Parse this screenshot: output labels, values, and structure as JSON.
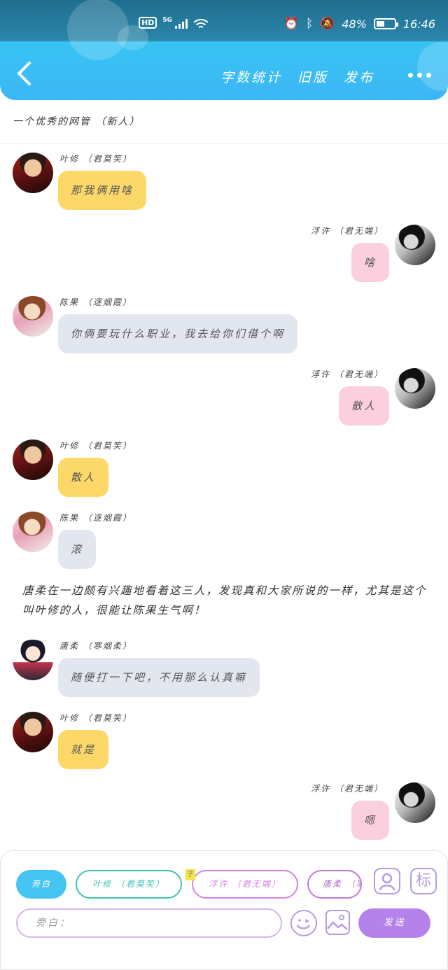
{
  "status_bar": {
    "hd_badge": "HD",
    "network": "5G",
    "battery_text": "48%",
    "battery_level": 0.48,
    "time": "16:46",
    "icons": [
      "alarm-icon",
      "bluetooth-icon",
      "vibrate-icon",
      "mute-icon"
    ]
  },
  "nav": {
    "back_icon": "chevron-left-icon",
    "links": [
      "字数统计",
      "旧版",
      "发布"
    ],
    "more_icon": "more-dots-icon"
  },
  "topic": {
    "title": "一个优秀的网管 （新人）"
  },
  "messages": [
    {
      "side": "left",
      "avatar": "ye",
      "sender": "叶修 （君莫笑）",
      "text": "那我俩用啥",
      "color": "yellow"
    },
    {
      "side": "right",
      "avatar": "fu",
      "sender": "浮许 （君无端）",
      "text": "啥",
      "color": "pink"
    },
    {
      "side": "left",
      "avatar": "chen",
      "sender": "陈果 （逐烟霞）",
      "text": "你俩要玩什么职业，我去给你们借个啊",
      "color": "gray"
    },
    {
      "side": "right",
      "avatar": "fu",
      "sender": "浮许 （君无端）",
      "text": "散人",
      "color": "pink"
    },
    {
      "side": "left",
      "avatar": "ye",
      "sender": "叶修 （君莫笑）",
      "text": "散人",
      "color": "yellow"
    },
    {
      "side": "left",
      "avatar": "chen",
      "sender": "陈果 （逐烟霞）",
      "text": "滚",
      "color": "gray"
    },
    {
      "side": "left",
      "avatar": "tang",
      "sender": "唐柔 （寒烟柔）",
      "text": "随便打一下吧，不用那么认真嘛",
      "color": "gray"
    },
    {
      "side": "left",
      "avatar": "ye",
      "sender": "叶修 （君莫笑）",
      "text": "就是",
      "color": "yellow"
    },
    {
      "side": "right",
      "avatar": "fu",
      "sender": "浮许 （君无端）",
      "text": "嗯",
      "color": "pink"
    }
  ],
  "narration": "唐柔在一边颇有兴趣地看着这三人，发现真和大家所说的一样，尤其是这个叫叶修的人，很能让陈果生气啊！",
  "composer": {
    "roles": [
      {
        "label": "旁白",
        "color": "#44c4f0"
      },
      {
        "label": "叶修 （君莫笑）",
        "color": "#3fc2b4"
      },
      {
        "label": "浮许 （君无端）",
        "color": "#d782e6"
      },
      {
        "label": "唐柔 （寒烟柔）",
        "color": "#c07ad8"
      }
    ],
    "sticker_tag": "子",
    "mark_button": "标",
    "input_placeholder": "旁白：",
    "send_label": "发送",
    "accent": "#b582ea"
  }
}
